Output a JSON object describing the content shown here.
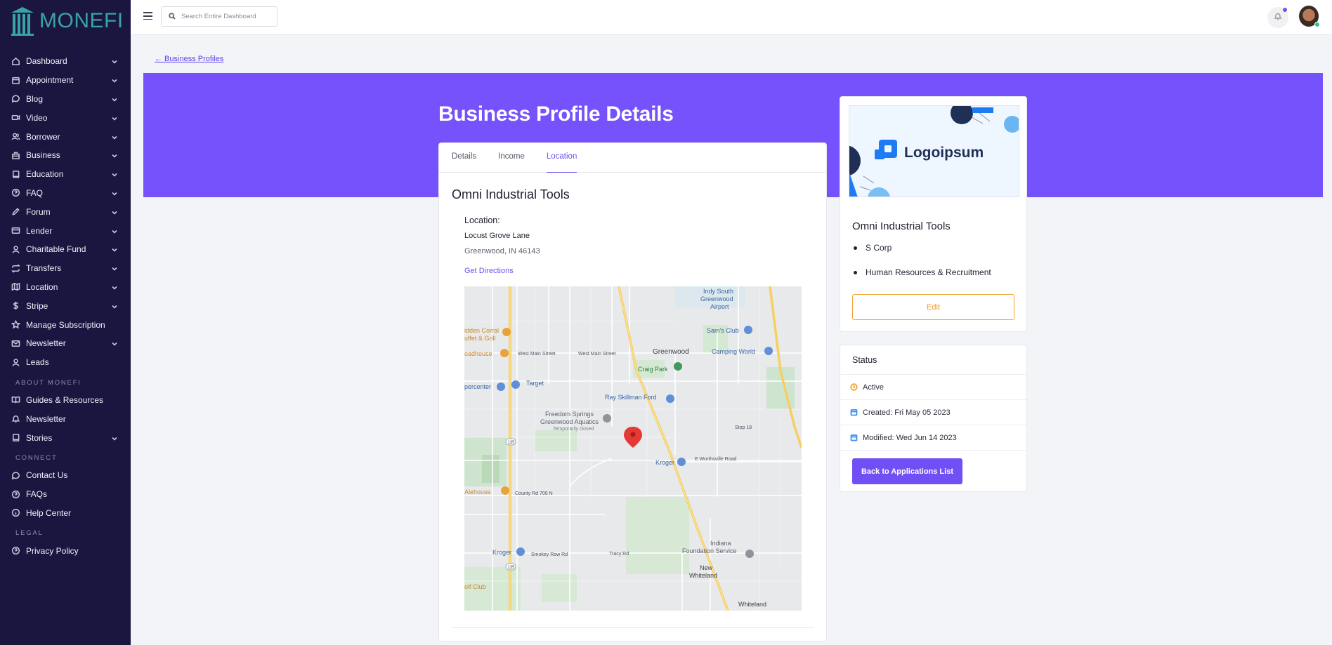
{
  "brand": {
    "name": "MONEFI",
    "accent": "#7552fb",
    "sidebar_bg": "#1a1640",
    "logo_color": "#3aa3a8"
  },
  "sidebar": {
    "items": [
      {
        "label": "Dashboard",
        "icon": "home-icon",
        "expandable": true
      },
      {
        "label": "Appointment",
        "icon": "calendar-icon",
        "expandable": true
      },
      {
        "label": "Blog",
        "icon": "chat-icon",
        "expandable": true
      },
      {
        "label": "Video",
        "icon": "video-icon",
        "expandable": true
      },
      {
        "label": "Borrower",
        "icon": "users-icon",
        "expandable": true
      },
      {
        "label": "Business",
        "icon": "building-icon",
        "expandable": true
      },
      {
        "label": "Education",
        "icon": "book-icon",
        "expandable": true
      },
      {
        "label": "FAQ",
        "icon": "help-circle-icon",
        "expandable": true
      },
      {
        "label": "Forum",
        "icon": "pencil-icon",
        "expandable": true
      },
      {
        "label": "Lender",
        "icon": "credit-card-icon",
        "expandable": true
      },
      {
        "label": "Charitable Fund",
        "icon": "user-icon",
        "expandable": true
      },
      {
        "label": "Transfers",
        "icon": "repeat-icon",
        "expandable": true
      },
      {
        "label": "Location",
        "icon": "map-icon",
        "expandable": true
      },
      {
        "label": "Stripe",
        "icon": "dollar-icon",
        "expandable": true
      },
      {
        "label": "Manage Subscription",
        "icon": "star-icon",
        "expandable": false
      },
      {
        "label": "Newsletter",
        "icon": "mail-icon",
        "expandable": true
      },
      {
        "label": "Leads",
        "icon": "user-icon",
        "expandable": false
      }
    ],
    "section_about": "ABOUT MONEFI",
    "about_items": [
      {
        "label": "Guides & Resources",
        "icon": "book-open-icon",
        "expandable": false
      },
      {
        "label": "Newsletter",
        "icon": "bell-icon",
        "expandable": false
      },
      {
        "label": "Stories",
        "icon": "book-icon",
        "expandable": true
      }
    ],
    "section_connect": "CONNECT",
    "connect_items": [
      {
        "label": "Contact Us",
        "icon": "chat-icon",
        "expandable": false
      },
      {
        "label": "FAQs",
        "icon": "help-circle-icon",
        "expandable": false
      },
      {
        "label": "Help Center",
        "icon": "info-icon",
        "expandable": false
      }
    ],
    "section_legal": "LEGAL",
    "legal_items": [
      {
        "label": "Privacy Policy",
        "icon": "help-circle-icon",
        "expandable": false
      }
    ]
  },
  "topbar": {
    "search_placeholder": "Search Entire Dashboard",
    "notification_icon": "bell-icon",
    "notification_dot_color": "#7050f5"
  },
  "content": {
    "back_link": "← Business Profiles",
    "page_title": "Business Profile Details",
    "tabs": [
      {
        "label": "Details",
        "active": false
      },
      {
        "label": "Income",
        "active": false
      },
      {
        "label": "Location",
        "active": true
      }
    ],
    "business_name": "Omni Industrial Tools",
    "location_label": "Location:",
    "street": "Locust Grove Lane",
    "city_state_zip": "Greenwood, IN 46143",
    "directions_label": "Get Directions",
    "map": {
      "labels": [
        "Indy South Greenwood Airport",
        "Sam's Club",
        "Camping World",
        "Greenwood",
        "Craig Park",
        "Target",
        "Ray Skillman Ford",
        "Freedom Springs Greenwood Aquatics",
        "Temporarily closed",
        "Kroger",
        "Indiana Foundation Service",
        "New Whiteland",
        "Whiteland",
        "olf Club",
        "Alehouse",
        "Kroger",
        "idden Corral uffet & Grill",
        "oadhouse",
        "percenter",
        "West Main Street",
        "West Main Street",
        "E Worthsville Road",
        "Smokey Row Rd",
        "Tracy Rd",
        "County Rd 700 N",
        "135",
        "135",
        "Stop 18"
      ]
    }
  },
  "profile_card": {
    "logo_text": "Logoipsum",
    "name": "Omni Industrial Tools",
    "tags": [
      "S Corp",
      "Human Resources & Recruitment"
    ],
    "edit_label": "Edit",
    "edit_color": "#f2a236"
  },
  "status_card": {
    "title": "Status",
    "status": "Active",
    "status_color": "#f2a236",
    "created": "Created: Fri May 05 2023",
    "modified": "Modified: Wed Jun 14 2023",
    "back_button": "Back to Applications List"
  }
}
